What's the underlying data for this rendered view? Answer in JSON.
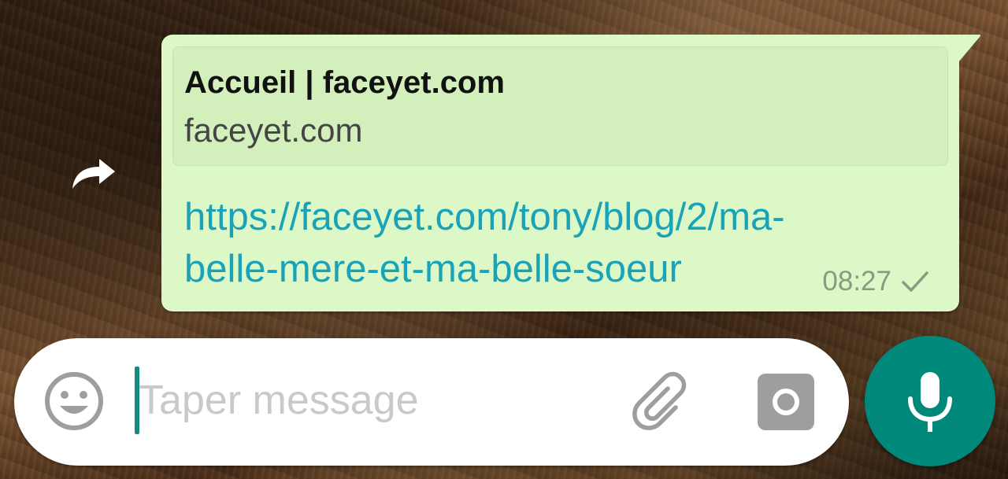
{
  "message": {
    "preview_title": "Accueil | faceyet.com",
    "preview_domain": "faceyet.com",
    "link_lines": [
      "https://faceyet.com/tony/blog/2/ma-",
      "belle-mere-et-ma-belle-soeur"
    ],
    "time": "08:27",
    "status_icon": "single-check-icon"
  },
  "composer": {
    "placeholder": "Taper message",
    "value": "",
    "emoji_icon": "smiley-icon",
    "attach_icon": "paperclip-icon",
    "camera_icon": "camera-icon",
    "mic_icon": "microphone-icon"
  },
  "colors": {
    "bubble": "#dcf8c6",
    "link": "#1aa3b8",
    "accent": "#00897b"
  }
}
